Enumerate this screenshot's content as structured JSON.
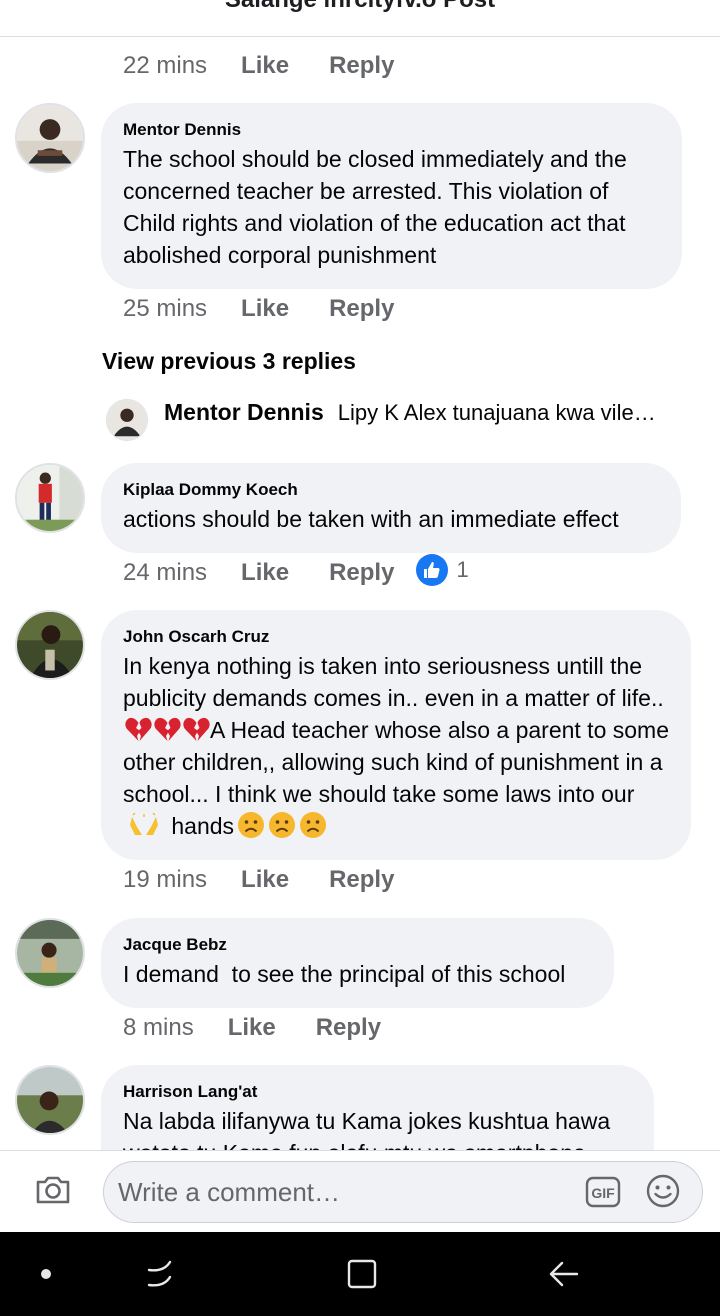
{
  "header": {
    "title": "Salange inrcityfv.o Post"
  },
  "comments": [
    {
      "author": "",
      "text": "",
      "time": "22 mins",
      "like_label": "Like",
      "reply_label": "Reply"
    },
    {
      "author": "Mentor Dennis",
      "text": "The school should be closed immediately and the concerned teacher be arrested. This violation of Child rights and violation of the education act that abolished corporal punishment",
      "time": "25 mins",
      "like_label": "Like",
      "reply_label": "Reply"
    },
    {
      "author": "Kiplaa Dommy Koech",
      "text": "actions should be taken with an immediate effect",
      "time": "24 mins",
      "like_label": "Like",
      "reply_label": "Reply",
      "reactions": "1"
    },
    {
      "author": "John Oscarh Cruz",
      "text_part1": "In kenya nothing is taken into seriousness untill the publicity demands comes in.. even in a matter of life.. ",
      "text_part2": "A Head teacher whose also a parent to some other children,, allowing such kind of punishment in a school... I think we should take some laws into our ",
      "text_part3": " hands",
      "time": "19 mins",
      "like_label": "Like",
      "reply_label": "Reply"
    },
    {
      "author": "Jacque Bebz",
      "text": "I demand  to see the principal of this school",
      "time": "8 mins",
      "like_label": "Like",
      "reply_label": "Reply"
    },
    {
      "author": "Harrison Lang'at",
      "text": "Na labda ilifanywa tu Kama jokes kushtua hawa watoto tu Kama fun alafu mtu wa smartphone"
    }
  ],
  "view_previous": "View previous 3 replies",
  "reply_preview": {
    "author": "Mentor Dennis",
    "text": "Lipy K Alex tunajuana kwa vile…"
  },
  "composer": {
    "placeholder": "Write a comment…"
  },
  "colors": {
    "link_blue": "#1877f2",
    "bubble_bg": "#f0f2f5",
    "meta_gray": "#65676b"
  },
  "icons": [
    "camera-icon",
    "gif-icon",
    "emoji-icon",
    "like-icon",
    "broken-heart-icon",
    "frowning-face-icon",
    "raised-hands-icon"
  ],
  "navbar": {
    "buttons": [
      "assistant-dot",
      "recent-apps",
      "home",
      "back"
    ]
  }
}
